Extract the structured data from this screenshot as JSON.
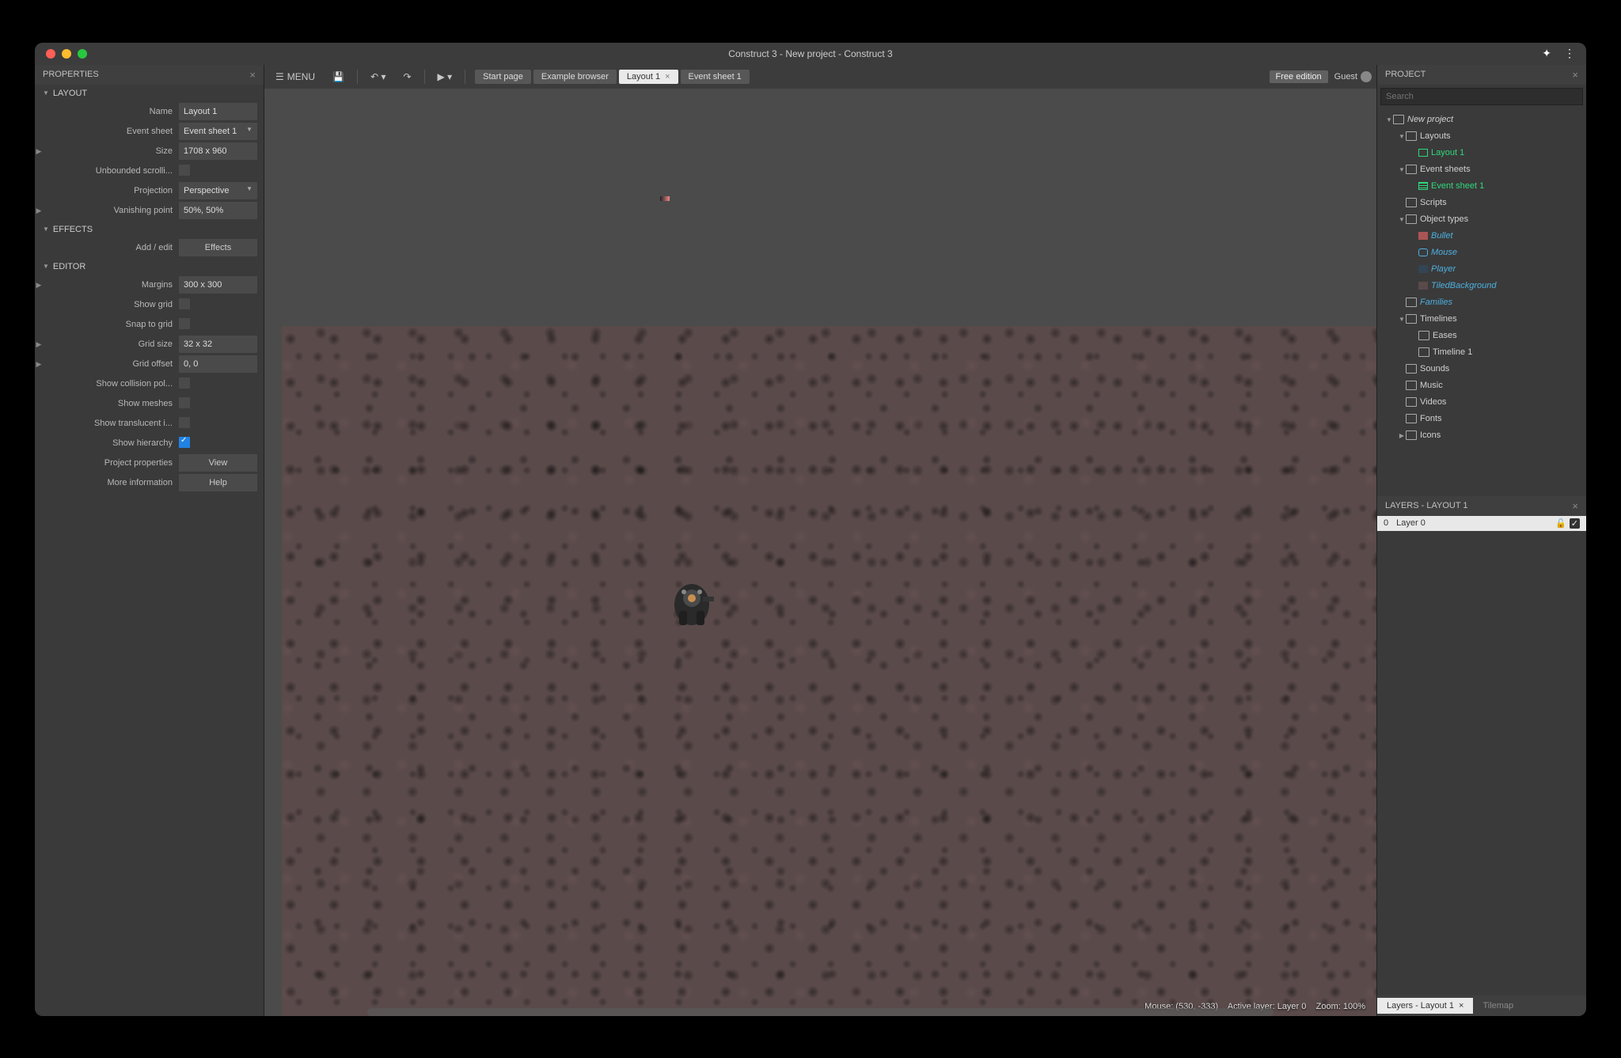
{
  "titlebar": {
    "title": "Construct 3 - New project - Construct 3"
  },
  "toolbar": {
    "menu_label": "MENU",
    "tabs": [
      {
        "label": "Start page",
        "active": false,
        "closable": false
      },
      {
        "label": "Example browser",
        "active": false,
        "closable": false
      },
      {
        "label": "Layout 1",
        "active": true,
        "closable": true
      },
      {
        "label": "Event sheet 1",
        "active": false,
        "closable": false
      }
    ],
    "free_edition": "Free edition",
    "guest": "Guest"
  },
  "properties_panel": {
    "title": "PROPERTIES",
    "sections": {
      "layout": {
        "title": "LAYOUT",
        "rows": {
          "name": {
            "label": "Name",
            "value": "Layout 1",
            "type": "text"
          },
          "event_sheet": {
            "label": "Event sheet",
            "value": "Event sheet 1",
            "type": "select"
          },
          "size": {
            "label": "Size",
            "value": "1708 x 960",
            "type": "text",
            "expandable": true
          },
          "unbounded": {
            "label": "Unbounded scrolli...",
            "checked": false,
            "type": "check"
          },
          "projection": {
            "label": "Projection",
            "value": "Perspective",
            "type": "select"
          },
          "vanishing": {
            "label": "Vanishing point",
            "value": "50%, 50%",
            "type": "text",
            "expandable": true
          }
        }
      },
      "effects": {
        "title": "EFFECTS",
        "rows": {
          "add_edit": {
            "label": "Add / edit",
            "button": "Effects"
          }
        }
      },
      "editor": {
        "title": "EDITOR",
        "rows": {
          "margins": {
            "label": "Margins",
            "value": "300 x 300",
            "type": "text",
            "expandable": true
          },
          "show_grid": {
            "label": "Show grid",
            "checked": false,
            "type": "check"
          },
          "snap_grid": {
            "label": "Snap to grid",
            "checked": false,
            "type": "check"
          },
          "grid_size": {
            "label": "Grid size",
            "value": "32 x 32",
            "type": "text",
            "expandable": true
          },
          "grid_offset": {
            "label": "Grid offset",
            "value": "0, 0",
            "type": "text",
            "expandable": true
          },
          "show_collision": {
            "label": "Show collision pol...",
            "checked": false,
            "type": "check"
          },
          "show_meshes": {
            "label": "Show meshes",
            "checked": false,
            "type": "check"
          },
          "show_translucent": {
            "label": "Show translucent i...",
            "checked": false,
            "type": "check"
          },
          "show_hierarchy": {
            "label": "Show hierarchy",
            "checked": true,
            "type": "check"
          },
          "project_props": {
            "label": "Project properties",
            "button": "View"
          },
          "more_info": {
            "label": "More information",
            "button": "Help"
          }
        }
      }
    }
  },
  "status": {
    "mouse": "Mouse: (530, -333)",
    "layer": "Active layer: Layer 0",
    "zoom": "Zoom: 100%"
  },
  "project_panel": {
    "title": "PROJECT",
    "search_placeholder": "Search",
    "tree": [
      {
        "depth": 1,
        "arrow": "▼",
        "icon": "folder",
        "label": "New project",
        "cls": "italic"
      },
      {
        "depth": 2,
        "arrow": "▼",
        "icon": "folder",
        "label": "Layouts"
      },
      {
        "depth": 3,
        "arrow": "",
        "icon": "layout",
        "label": "Layout 1",
        "cls": "link-green"
      },
      {
        "depth": 2,
        "arrow": "▼",
        "icon": "folder",
        "label": "Event sheets"
      },
      {
        "depth": 3,
        "arrow": "",
        "icon": "event",
        "label": "Event sheet 1",
        "cls": "link-green"
      },
      {
        "depth": 2,
        "arrow": "",
        "icon": "folder",
        "label": "Scripts"
      },
      {
        "depth": 2,
        "arrow": "▼",
        "icon": "folder",
        "label": "Object types"
      },
      {
        "depth": 3,
        "arrow": "",
        "icon": "obj-bullet",
        "label": "Bullet",
        "cls": "link-blue"
      },
      {
        "depth": 3,
        "arrow": "",
        "icon": "obj-mouse",
        "label": "Mouse",
        "cls": "link-blue"
      },
      {
        "depth": 3,
        "arrow": "",
        "icon": "obj-player",
        "label": "Player",
        "cls": "link-blue"
      },
      {
        "depth": 3,
        "arrow": "",
        "icon": "obj-tiled",
        "label": "TiledBackground",
        "cls": "link-blue"
      },
      {
        "depth": 2,
        "arrow": "",
        "icon": "folder",
        "label": "Families",
        "cls": "link-bluefam"
      },
      {
        "depth": 2,
        "arrow": "▼",
        "icon": "folder",
        "label": "Timelines"
      },
      {
        "depth": 3,
        "arrow": "",
        "icon": "folder",
        "label": "Eases"
      },
      {
        "depth": 3,
        "arrow": "",
        "icon": "folder",
        "label": "Timeline 1"
      },
      {
        "depth": 2,
        "arrow": "",
        "icon": "folder",
        "label": "Sounds"
      },
      {
        "depth": 2,
        "arrow": "",
        "icon": "folder",
        "label": "Music"
      },
      {
        "depth": 2,
        "arrow": "",
        "icon": "folder",
        "label": "Videos"
      },
      {
        "depth": 2,
        "arrow": "",
        "icon": "folder",
        "label": "Fonts"
      },
      {
        "depth": 2,
        "arrow": "▶",
        "icon": "folder",
        "label": "Icons"
      }
    ]
  },
  "layers_panel": {
    "title": "LAYERS - LAYOUT 1",
    "layer": {
      "index": "0",
      "name": "Layer 0"
    },
    "tabs": [
      {
        "label": "Layers - Layout 1",
        "active": true,
        "closable": true
      },
      {
        "label": "Tilemap",
        "active": false,
        "closable": false
      }
    ]
  }
}
